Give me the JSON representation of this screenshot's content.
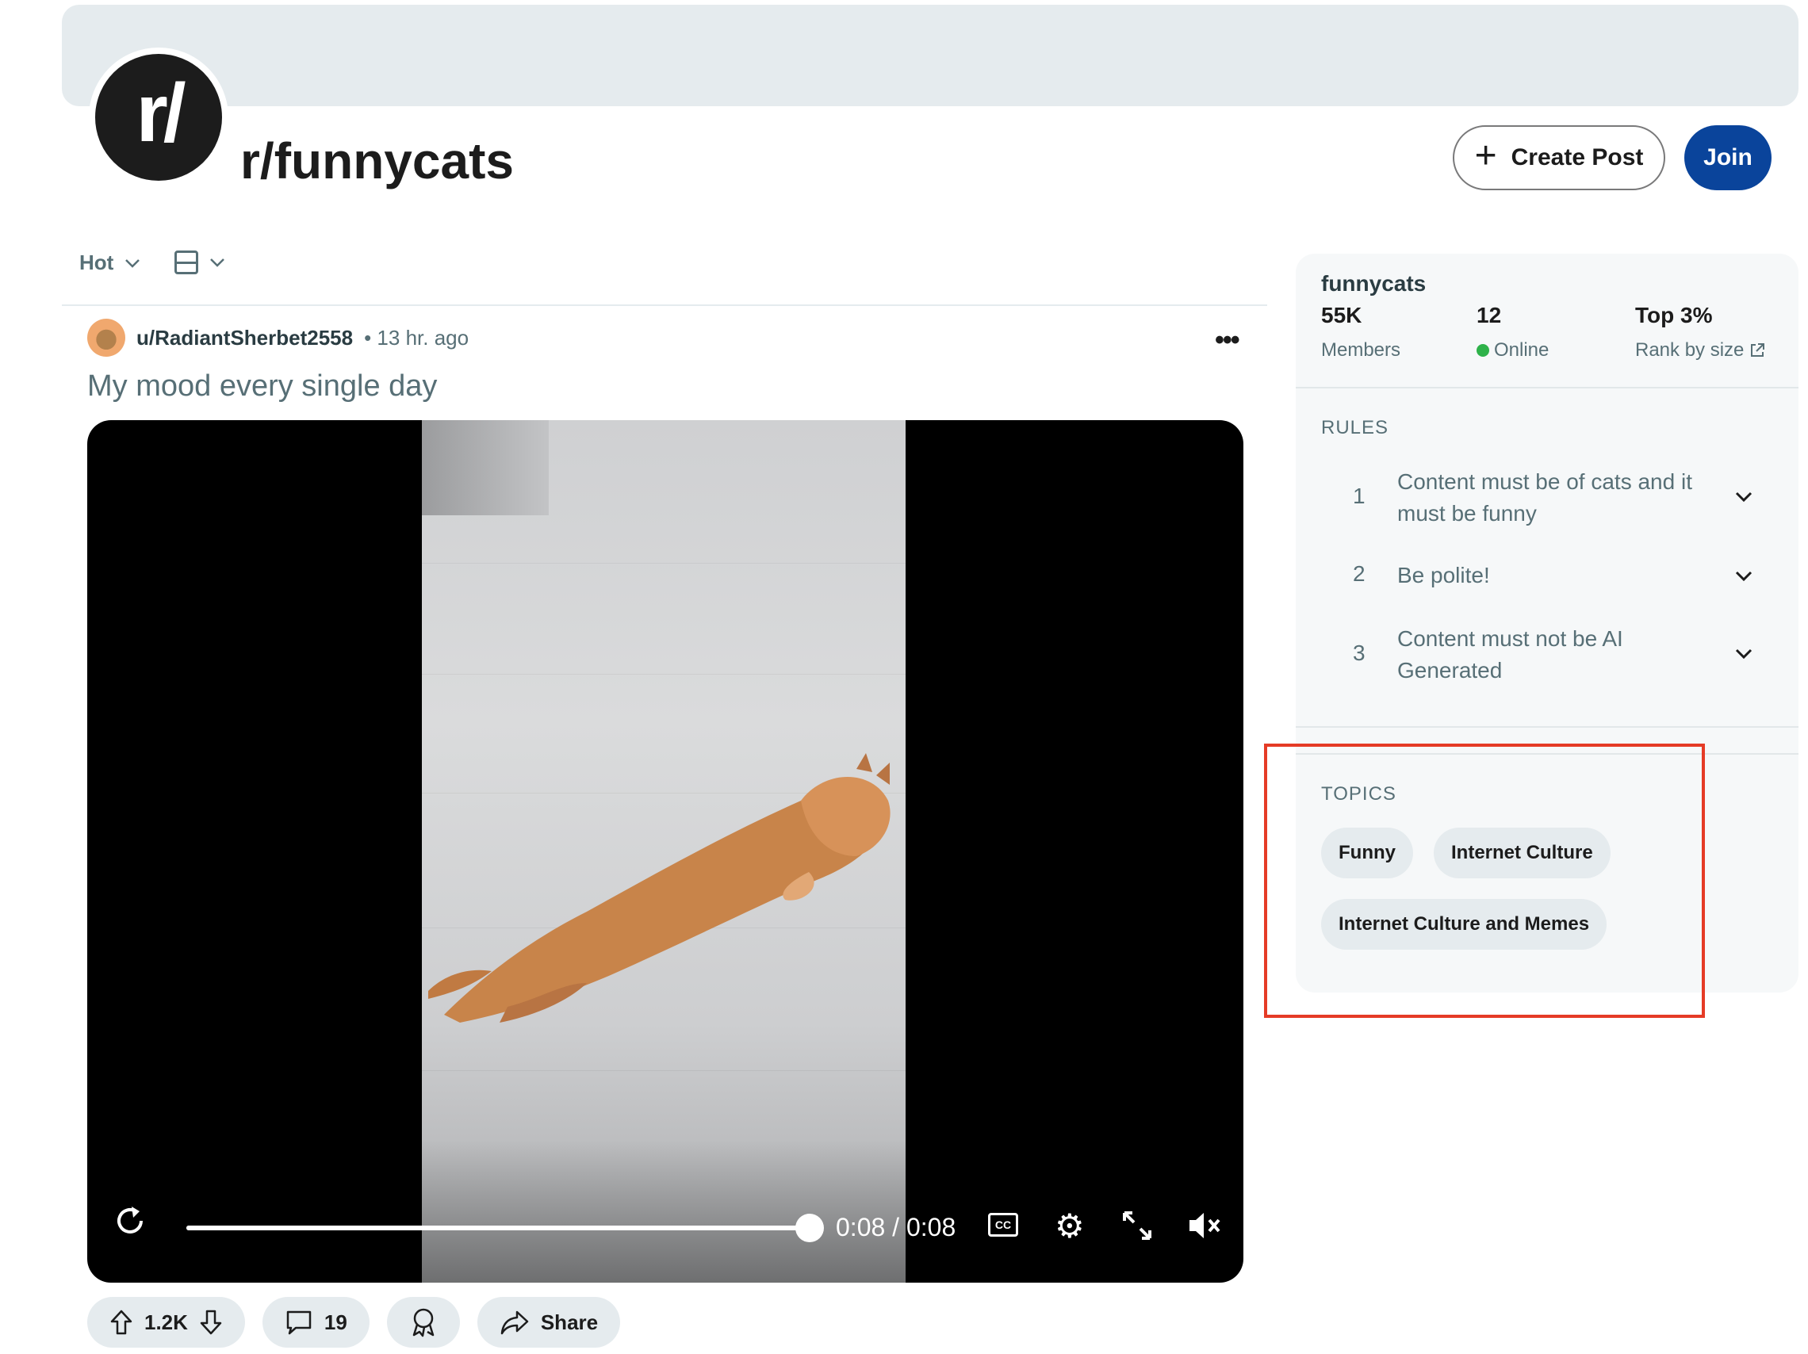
{
  "header": {
    "avatar_text": "r/",
    "subreddit_title": "r/funnycats",
    "create_post_label": "Create Post",
    "join_label": "Join"
  },
  "sort": {
    "sort_label": "Hot"
  },
  "post": {
    "username": "u/RadiantSherbet2558",
    "time_ago": "• 13 hr. ago",
    "more_label": "•••",
    "title": "My mood every single day",
    "video": {
      "time_display": "0:08 / 0:08",
      "progress_percent": 100,
      "cc_label": "CC"
    },
    "actions": {
      "votes": "1.2K",
      "comments": "19",
      "share_label": "Share"
    }
  },
  "sidebar": {
    "name": "funnycats",
    "stats": [
      {
        "value": "55K",
        "label": "Members"
      },
      {
        "value": "12",
        "label": "Online"
      },
      {
        "value": "Top 3%",
        "label": "Rank by size"
      }
    ],
    "rules_heading": "RULES",
    "rules": [
      {
        "num": "1",
        "text": "Content must be of cats and it must be funny"
      },
      {
        "num": "2",
        "text": "Be polite!"
      },
      {
        "num": "3",
        "text": "Content must not be AI Generated"
      }
    ],
    "topics_heading": "TOPICS",
    "topics": [
      "Funny",
      "Internet Culture",
      "Internet Culture and Memes"
    ]
  },
  "colors": {
    "join_button": "#0a449b",
    "online_dot": "#2eb24a",
    "highlight_box": "#e53b26"
  }
}
